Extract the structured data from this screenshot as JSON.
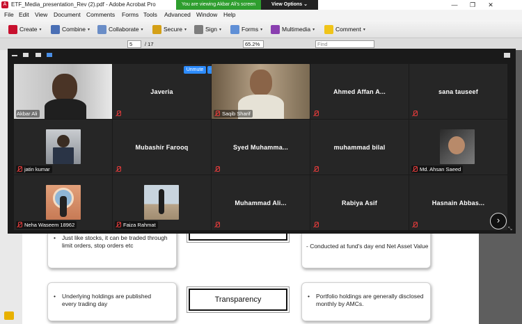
{
  "acrobat": {
    "window_title": "ETF_Media_presentation_Rev (2).pdf - Adobe Acrobat Pro",
    "app_icon_glyph": "A",
    "minimize_glyph": "—",
    "restore_glyph": "❐",
    "close_glyph": "✕",
    "menu": [
      "File",
      "Edit",
      "View",
      "Document",
      "Comments",
      "Forms",
      "Tools",
      "Advanced",
      "Window",
      "Help"
    ],
    "toolbar": [
      "Create",
      "Combine",
      "Collaborate",
      "Secure",
      "Sign",
      "Forms",
      "Multimedia",
      "Comment"
    ],
    "caret": "▾",
    "page_current": "5",
    "page_total": "/ 17",
    "zoom_level": "65.2%",
    "find_placeholder": "Find"
  },
  "share": {
    "banner": "You are viewing Akbar Ali's screen",
    "view_options": "View Options ⌄"
  },
  "slide": {
    "left_top": "Just like stocks, it can be traded through limit orders, stop orders etc",
    "right_top": "- Conducted at fund's day end Net Asset Value",
    "left_bottom": "Underlying holdings are published every trading day",
    "center_bottom": "Transparency",
    "right_bottom": "Portfolio holdings are generally disclosed monthly by AMCs.",
    "bullet": "•"
  },
  "zoom": {
    "unmute_label": "Unmute",
    "more_label": "···",
    "next_glyph": "›",
    "resize_glyph": "⤡",
    "participants": [
      {
        "name": "Akbar Ali",
        "video": true
      },
      {
        "name": "Javeria",
        "video": false
      },
      {
        "name": "Saqib Sharif",
        "video": true
      },
      {
        "name": "Ahmed Affan A...",
        "video": false
      },
      {
        "name": "sana tauseef",
        "video": false
      },
      {
        "name": "jatin kumar",
        "video": true
      },
      {
        "name": "Mubashir Farooq",
        "video": false
      },
      {
        "name": "Syed  Muhamma...",
        "video": false
      },
      {
        "name": "muhammad bilal",
        "video": false
      },
      {
        "name": "Md. Ahsan Saeed",
        "video": true
      },
      {
        "name": "Neha Waseem 18962",
        "video": true
      },
      {
        "name": "Faiza Rahmat",
        "video": true
      },
      {
        "name": "Muhammad  Ali...",
        "video": false
      },
      {
        "name": "Rabiya Asif",
        "video": false
      },
      {
        "name": "Hasnain  Abbas...",
        "video": false
      }
    ]
  },
  "colors": {
    "share_banner": "#2e9e2e",
    "active_speaker": "#b8e05a",
    "unmute": "#2d8cff",
    "muted_mic": "#e23b3b"
  }
}
